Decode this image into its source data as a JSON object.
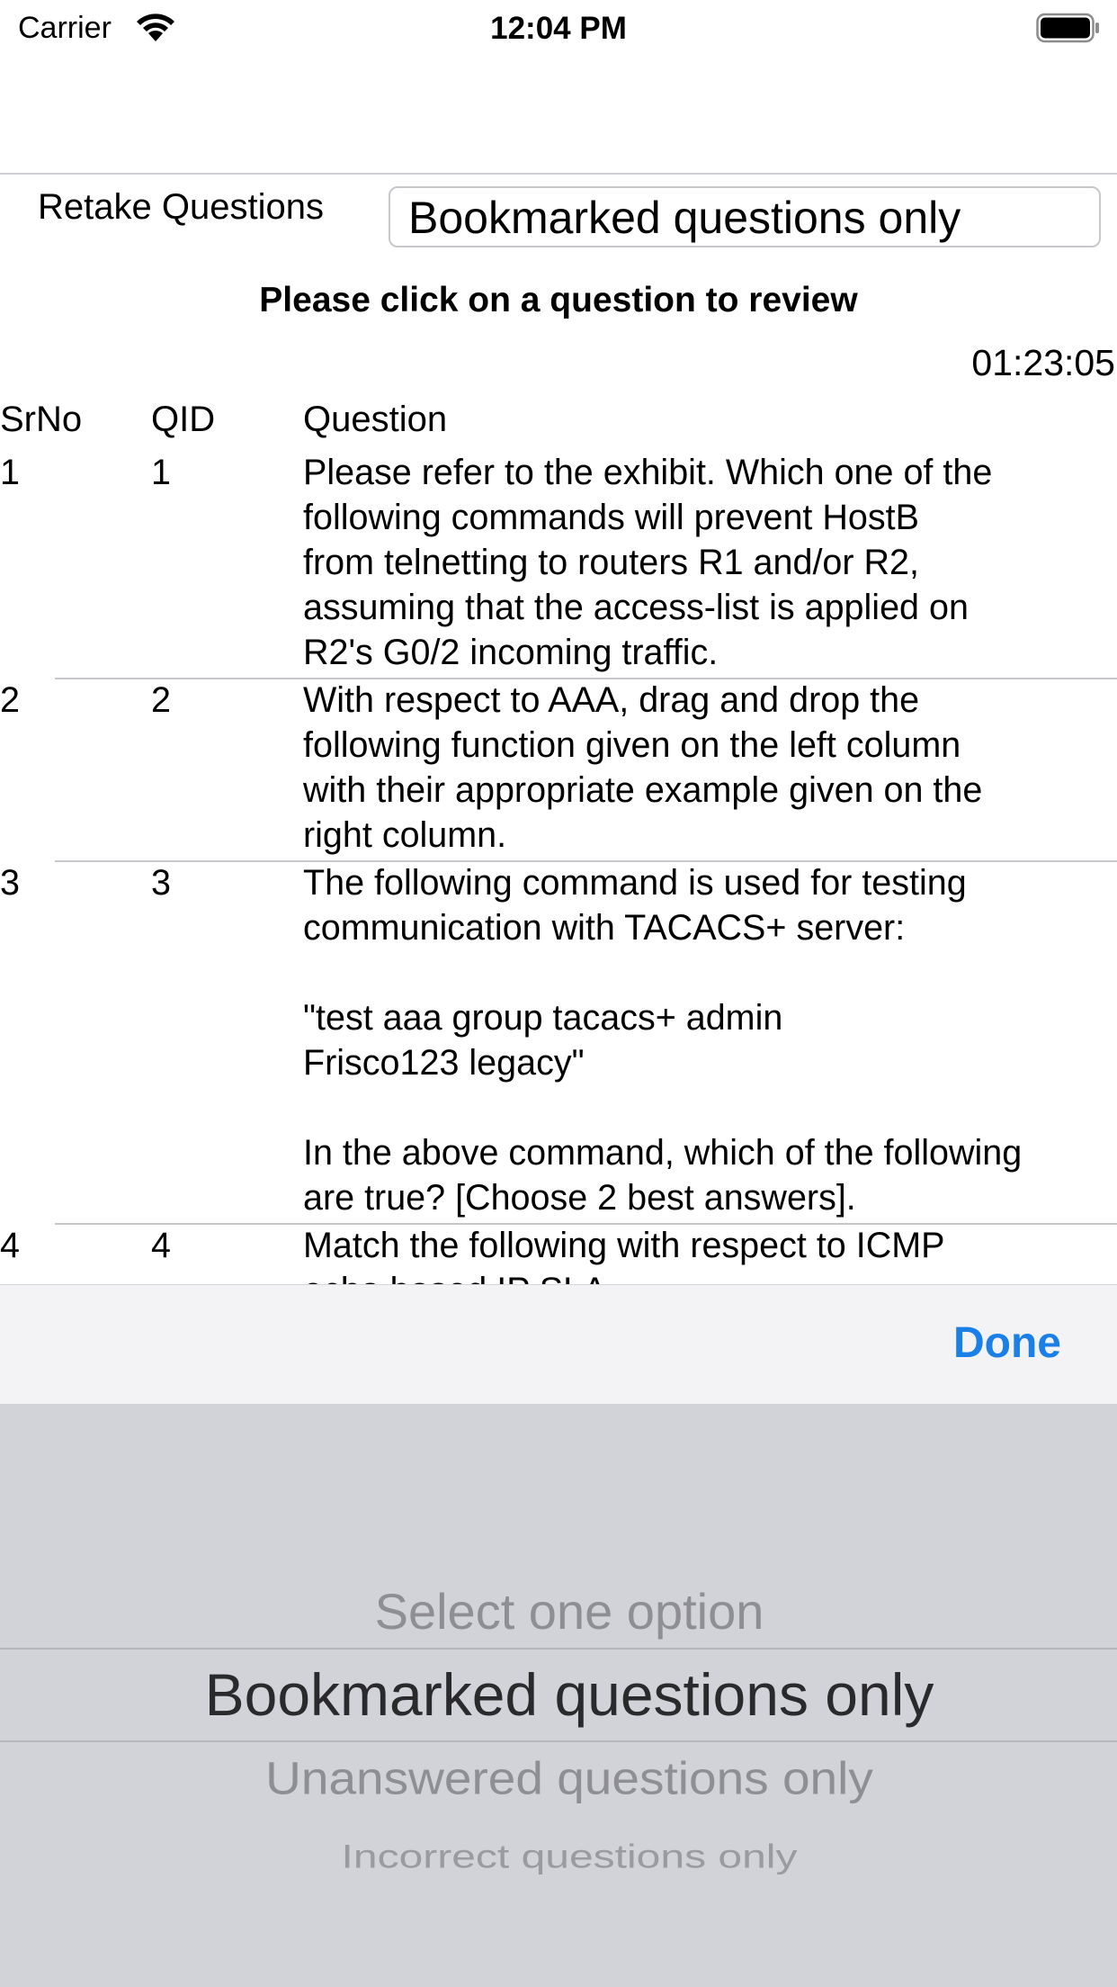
{
  "status_bar": {
    "carrier": "Carrier",
    "time": "12:04 PM"
  },
  "filter": {
    "label": "Retake Questions",
    "selected": "Bookmarked questions only"
  },
  "instruction": "Please click on a question to review",
  "timer": "01:23:05",
  "table": {
    "headers": [
      "SrNo",
      "QID",
      "Question"
    ],
    "rows": [
      {
        "srno": "1",
        "qid": "1",
        "question": "Please refer to the exhibit. Which one of the\nfollowing commands will prevent HostB\nfrom telnetting to routers R1 and/or R2,\nassuming that the access-list is applied on\nR2's G0/2 incoming traffic."
      },
      {
        "srno": "2",
        "qid": "2",
        "question": "With respect to AAA, drag and drop the\nfollowing function given on the left column\nwith their appropriate example given on the\nright column."
      },
      {
        "srno": "3",
        "qid": "3",
        "question": "The following command is used for testing\ncommunication with TACACS+ server:\n\n\"test aaa group tacacs+ admin\nFrisco123 legacy\"\n\nIn the above command, which of the following\nare true? [Choose 2 best answers]."
      },
      {
        "srno": "4",
        "qid": "4",
        "question": "Match the following with respect to ICMP\necho based IP SLA."
      }
    ]
  },
  "picker": {
    "done_label": "Done",
    "options": [
      "Select one option",
      "Bookmarked questions only",
      "Unanswered questions only",
      "Incorrect questions only"
    ],
    "selected_index": 1
  },
  "colors": {
    "accent": "#1a7fe6",
    "picker_background": "#d1d3d9",
    "toolbar_background": "#f3f3f5"
  }
}
